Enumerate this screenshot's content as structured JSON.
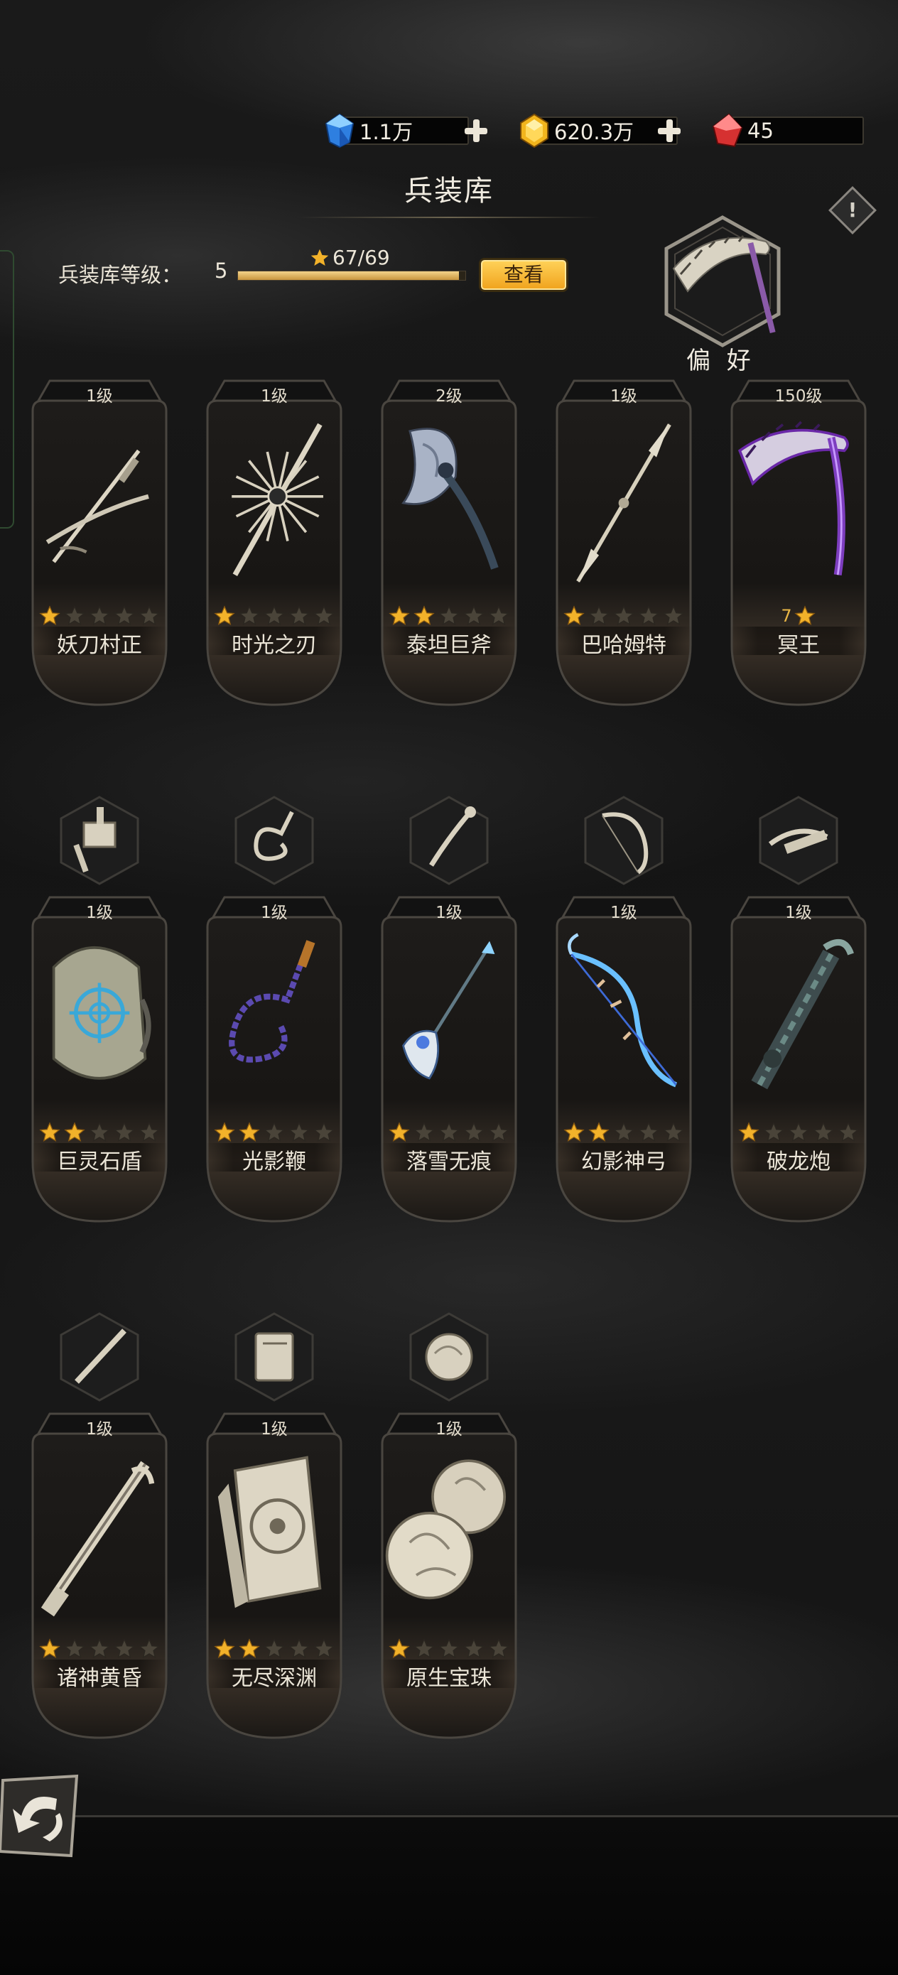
{
  "resources": [
    {
      "name": "blue-crystal",
      "value": "1.1万",
      "color": "#3a8fe6",
      "has_plus": true
    },
    {
      "name": "gold-crystal",
      "value": "620.3万",
      "color": "#f2b51d",
      "has_plus": true
    },
    {
      "name": "red-crystal",
      "value": "45",
      "color": "#d63131",
      "has_plus": false
    }
  ],
  "header": {
    "title": "兵装库",
    "info_icon": "exclamation-diamond-icon"
  },
  "armory": {
    "level_label": "兵装库等级：",
    "level_value": "5",
    "progress_text": "67/69",
    "progress_fraction": 0.971,
    "view_button": "查看"
  },
  "preference": {
    "label": "偏 好",
    "icon": "scythe-icon"
  },
  "rows": [
    [
      {
        "level": "1级",
        "name": "妖刀村正",
        "stars": 1,
        "icon": "katana-icon"
      },
      {
        "level": "1级",
        "name": "时光之刃",
        "stars": 1,
        "icon": "spiked-blade-icon"
      },
      {
        "level": "2级",
        "name": "泰坦巨斧",
        "stars": 2,
        "icon": "axe-icon"
      },
      {
        "level": "1级",
        "name": "巴哈姆特",
        "stars": 1,
        "icon": "spear-icon"
      },
      {
        "level": "150级",
        "name": "冥王",
        "rank": "7",
        "icon": "scythe-icon"
      }
    ],
    [
      {
        "level": "1级",
        "name": "巨灵石盾",
        "stars": 2,
        "icon": "stone-shield-icon"
      },
      {
        "level": "1级",
        "name": "光影鞭",
        "stars": 2,
        "icon": "whip-icon"
      },
      {
        "level": "1级",
        "name": "落雪无痕",
        "stars": 1,
        "icon": "scepter-icon"
      },
      {
        "level": "1级",
        "name": "幻影神弓",
        "stars": 2,
        "icon": "bow-icon"
      },
      {
        "level": "1级",
        "name": "破龙炮",
        "stars": 1,
        "icon": "cannon-icon"
      }
    ],
    [
      {
        "level": "1级",
        "name": "诸神黄昏",
        "stars": 1,
        "icon": "rifle-icon"
      },
      {
        "level": "1级",
        "name": "无尽深渊",
        "stars": 2,
        "icon": "tome-icon"
      },
      {
        "level": "1级",
        "name": "原生宝珠",
        "stars": 1,
        "icon": "orb-icon"
      }
    ]
  ],
  "type_hexes": [
    {
      "icon": "hammer-icon"
    },
    {
      "icon": "whip-icon"
    },
    {
      "icon": "staff-icon"
    },
    {
      "icon": "bow-icon"
    },
    {
      "icon": "crossbow-icon"
    },
    {
      "icon": "rifle-icon"
    },
    {
      "icon": "tome-icon"
    },
    {
      "icon": "orb-icon"
    }
  ],
  "colors": {
    "star_gold": "#f2b22a",
    "star_empty": "#4a4439",
    "button_gold": "#f7b733",
    "level_tag": "#e4ddcd"
  },
  "back_button": {
    "icon": "back-arrow-icon"
  }
}
